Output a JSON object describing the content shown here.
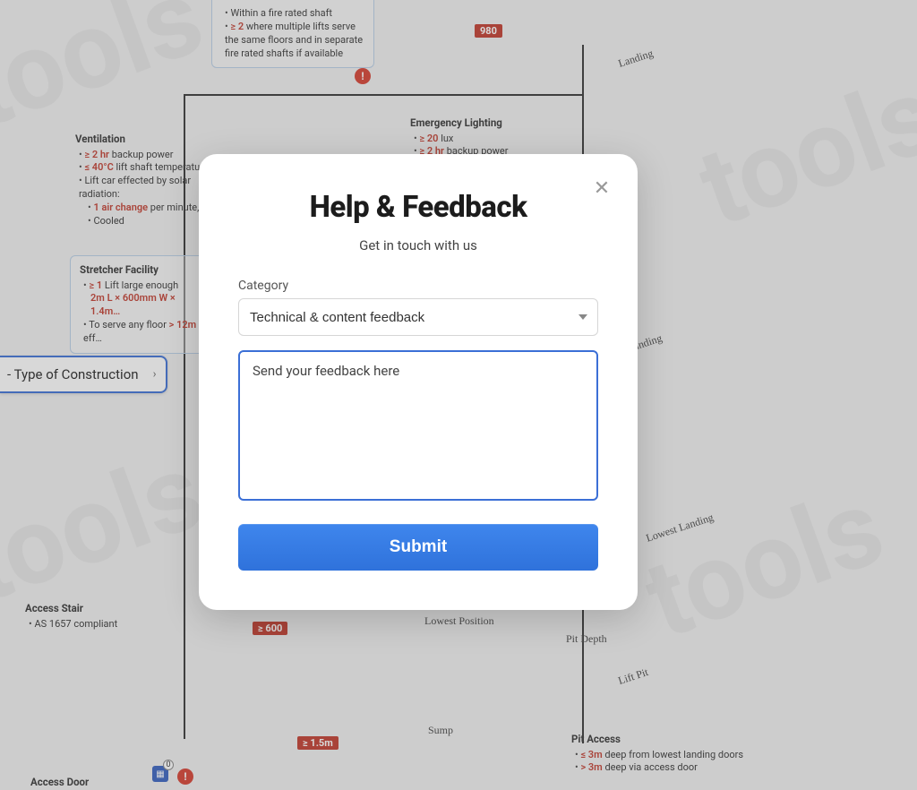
{
  "modal": {
    "title": "Help & Feedback",
    "subtitle": "Get in touch with us",
    "category_label": "Category",
    "category_value": "Technical & content feedback",
    "feedback_placeholder": "Send your feedback here",
    "submit_label": "Submit",
    "close_aria": "Close"
  },
  "nav": {
    "construction_label": "- Type of Construction"
  },
  "background": {
    "watermark_text": "tools",
    "dimensions": {
      "d980": "980",
      "d600": "≥ 600",
      "d15m": "≥ 1.5m"
    },
    "sketch_labels": {
      "landing": "Landing",
      "lowest_landing": "Lowest Landing",
      "lowest_position": "Lowest Position",
      "pit_depth": "Pit Depth",
      "lift_pit": "Lift Pit",
      "sump": "Sump"
    },
    "fire_shaft": {
      "line1": "Within a fire rated shaft",
      "line2_prefix": "≥ 2",
      "line2_rest": " where multiple lifts serve the same floors and in separate fire rated shafts if available"
    },
    "ventilation": {
      "title": "Ventilation",
      "l1_prefix": "≥ 2 hr",
      "l1_rest": " backup power",
      "l2_prefix": "≤ 40°C",
      "l2_rest": " lift shaft temperature",
      "l3": "Lift car effected by solar radiation:",
      "l3a_prefix": "1 air change",
      "l3a_rest": " per minute, or",
      "l3b": "Cooled"
    },
    "emergency_lighting": {
      "title": "Emergency Lighting",
      "l1_prefix": "≥ 20",
      "l1_rest": " lux",
      "l2_prefix": "≥ 2 hr",
      "l2_rest": " backup power"
    },
    "stretcher": {
      "title": "Stretcher Facility",
      "l1_prefix": "≥ 1",
      "l1_rest": " Lift large enough",
      "l2": "2m L × 600mm W × 1.4m…",
      "l3_prefix": "> 12m",
      "l3_rest_pre": "To serve any floor ",
      "l3_rest_post": " eff…"
    },
    "access_stair": {
      "title": "Access Stair",
      "l1": "AS 1657 compliant"
    },
    "access_door": {
      "title": "Access Door"
    },
    "pit_access": {
      "title": "Pit Access",
      "l1_prefix": "≤ 3m",
      "l1_mid": " deep",
      "l1_rest": " from lowest landing doors",
      "l2_prefix": "> 3m",
      "l2_mid": " deep",
      "l2_rest": " via access door"
    }
  }
}
